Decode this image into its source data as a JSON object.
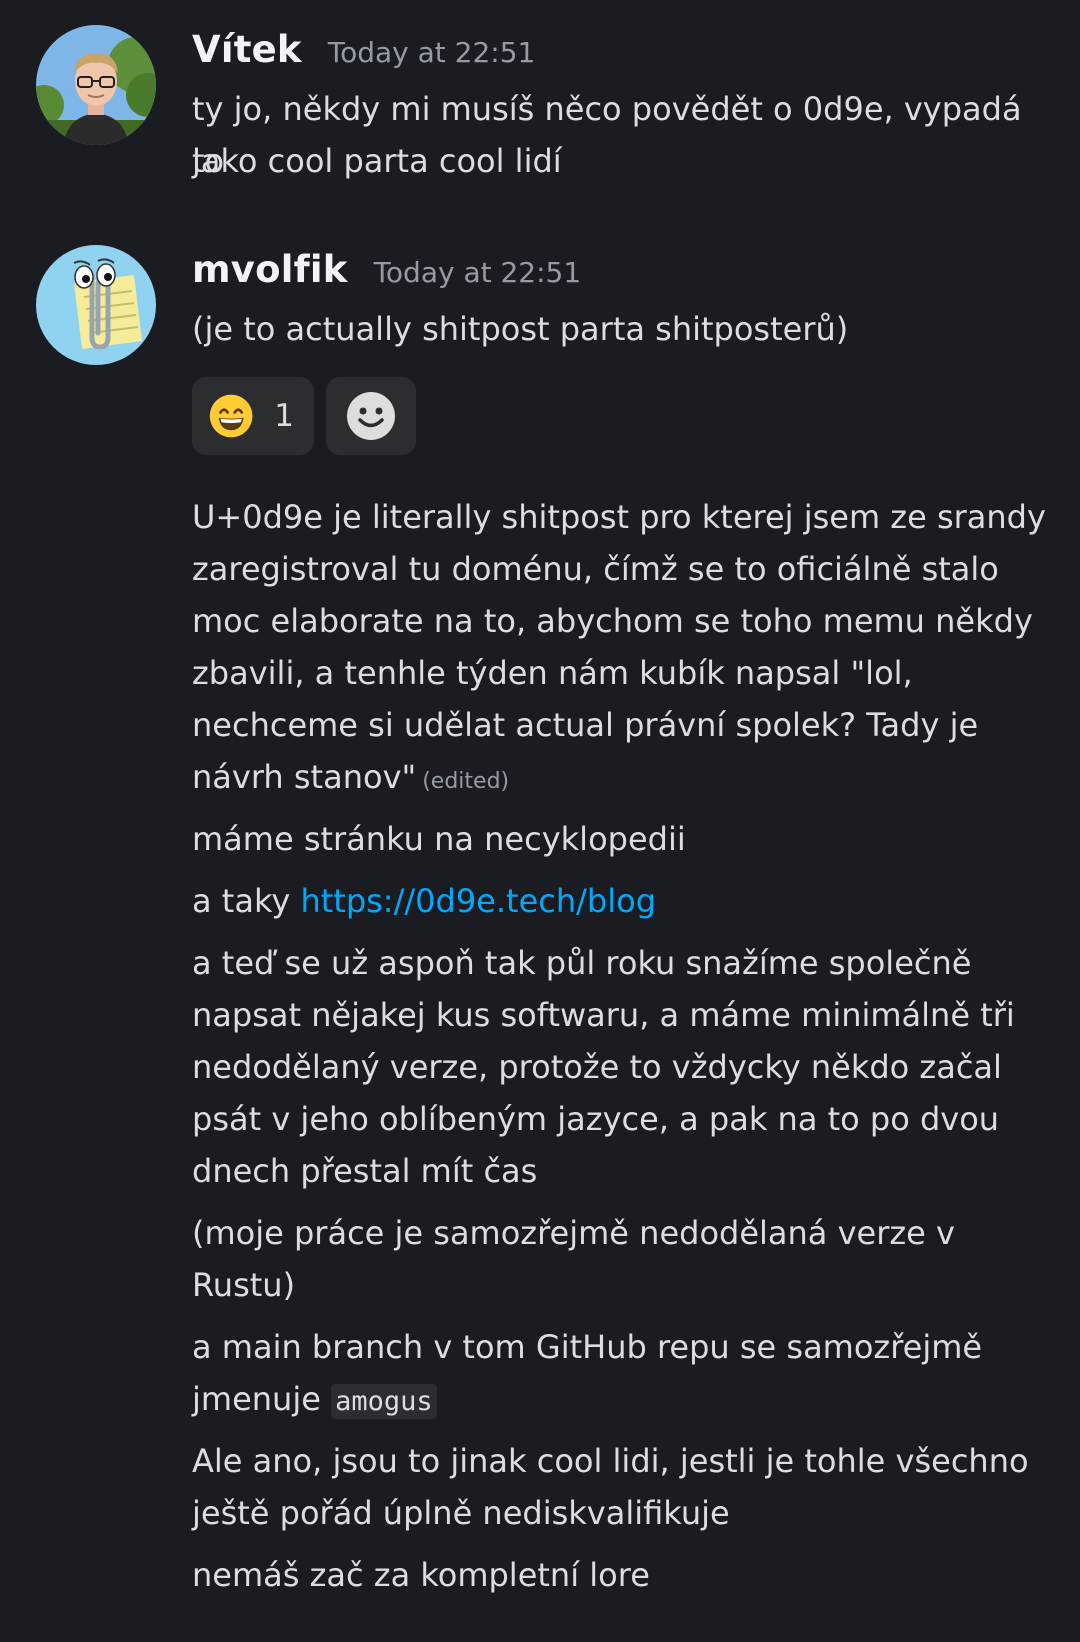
{
  "messages": [
    {
      "author": "Vítek",
      "timestamp": "Today at 22:51",
      "avatar_icon": "person-photo-avatar",
      "lines": [
        "ty jo, někdy mi musíš něco povědět o 0d9e, vypadá to",
        "jako cool parta cool lidí"
      ]
    },
    {
      "author": "mvolfik",
      "timestamp": "Today at 22:51",
      "avatar_icon": "paperclip-avatar",
      "lines": [
        "(je to actually shitpost parta shitposterů)"
      ],
      "reactions": [
        {
          "emoji": "😄",
          "icon": "grinning-emoji-icon",
          "count": "1"
        },
        {
          "icon": "add-reaction-icon"
        }
      ]
    }
  ],
  "followups": {
    "p1": [
      "U+0d9e je literally shitpost pro kterej jsem ze srandy",
      "zaregistroval tu doménu, čímž se to oficiálně stalo",
      "moc elaborate na to, abychom se toho memu někdy",
      "zbavili, a tenhle týden nám kubík napsal \"lol,",
      "nechceme si udělat actual právní spolek? Tady je",
      "návrh stanov\""
    ],
    "p1_edited": "(edited)",
    "p2": "máme stránku na necyklopedii",
    "p3_prefix": "a taky ",
    "p3_link": "https://0d9e.tech/blog",
    "p4": [
      "a teď se už aspoň tak půl roku snažíme společně",
      "napsat nějakej kus softwaru, a máme minimálně tři",
      "nedodělaný verze, protože to vždycky někdo začal",
      "psát v jeho oblíbeným jazyce, a pak na to po dvou",
      "dnech přestal mít čas"
    ],
    "p5": [
      "(moje práce je samozřejmě nedodělaná verze v",
      "Rustu)"
    ],
    "p6_line1": "a main branch v tom GitHub repu se samozřejmě",
    "p6_prefix": "jmenuje ",
    "p6_code": "amogus",
    "p7": [
      "Ale ano, jsou to jinak cool lidi, jestli je tohle všechno",
      "ještě pořád úplně nediskvalifikuje"
    ],
    "p8": "nemáš zač za kompletní lore"
  }
}
